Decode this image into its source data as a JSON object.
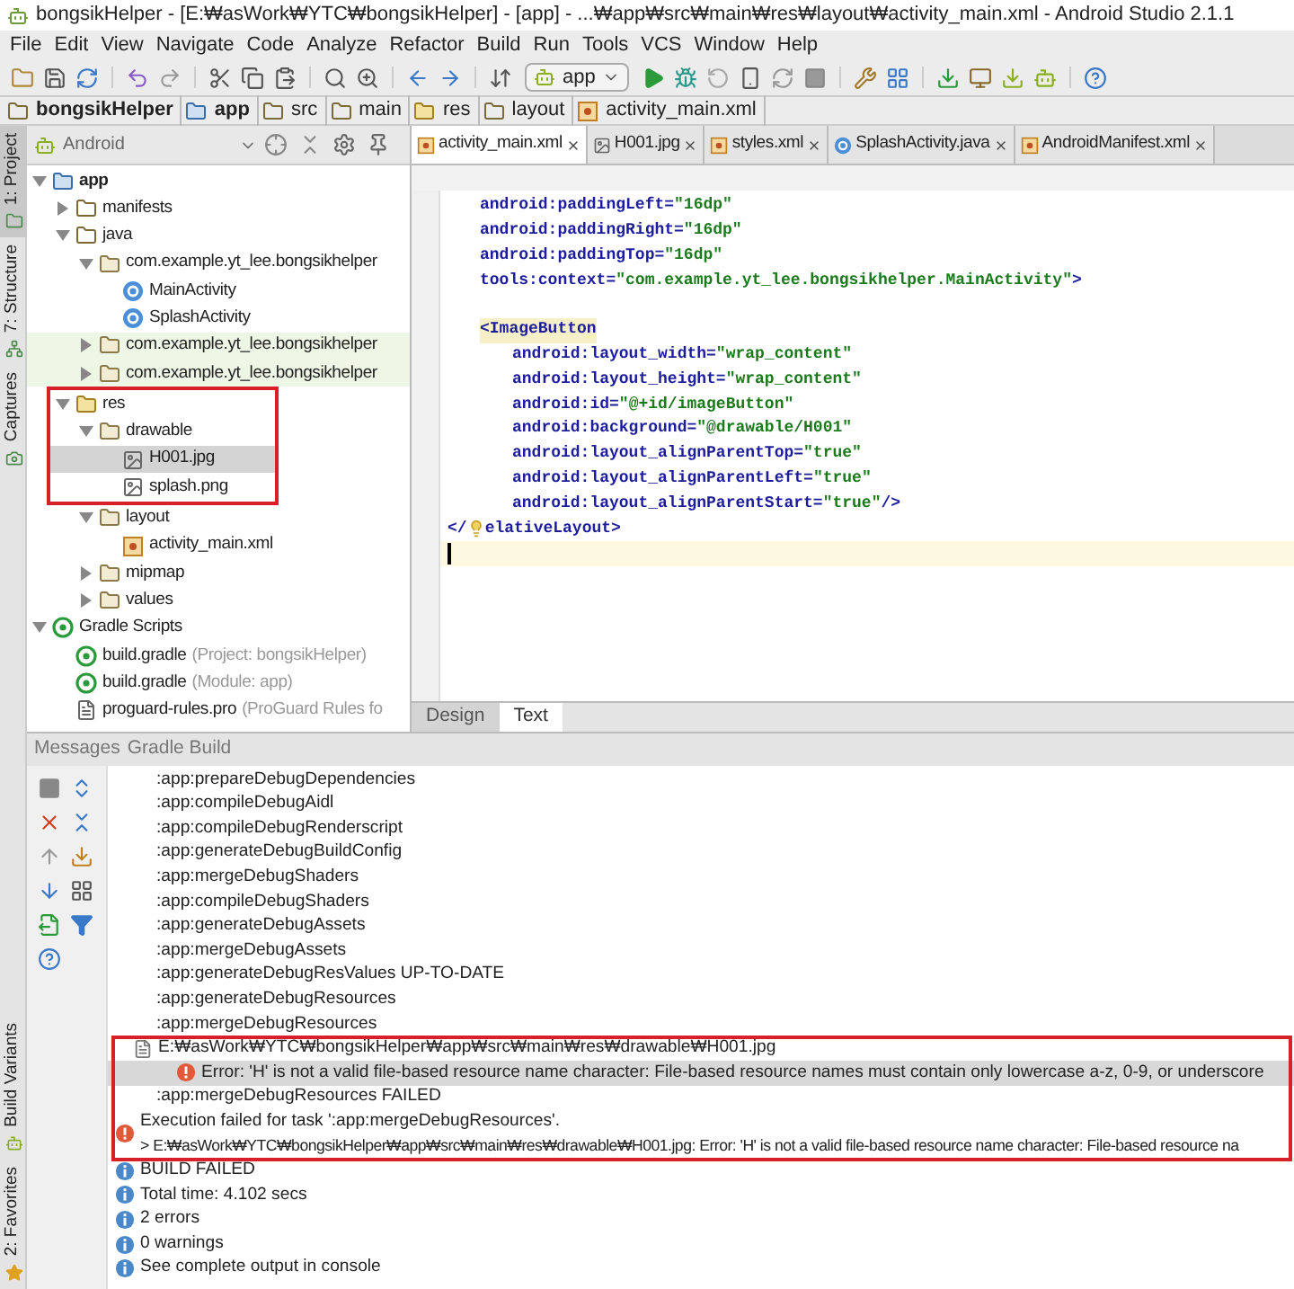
{
  "window": {
    "title": "bongsikHelper - [E:₩asWork₩YTC₩bongsikHelper] - [app] - ...₩app₩src₩main₩res₩layout₩activity_main.xml - Android Studio 2.1.1"
  },
  "menu": [
    "File",
    "Edit",
    "View",
    "Navigate",
    "Code",
    "Analyze",
    "Refactor",
    "Build",
    "Run",
    "Tools",
    "VCS",
    "Window",
    "Help"
  ],
  "toolbar": {
    "run_config": "app"
  },
  "breadcrumb": [
    {
      "label": "bongsikHelper",
      "kind": "project"
    },
    {
      "label": "app",
      "kind": "module"
    },
    {
      "label": "src",
      "kind": "folder"
    },
    {
      "label": "main",
      "kind": "folder"
    },
    {
      "label": "res",
      "kind": "res"
    },
    {
      "label": "layout",
      "kind": "folder"
    },
    {
      "label": "activity_main.xml",
      "kind": "xml"
    }
  ],
  "tool_strip": {
    "top": [
      {
        "label": "1: Project",
        "kind": "project",
        "selected": true
      },
      {
        "label": "7: Structure",
        "kind": "structure",
        "selected": false
      },
      {
        "label": "Captures",
        "kind": "captures",
        "selected": false
      }
    ],
    "bottom": [
      {
        "label": "Build Variants",
        "kind": "android",
        "selected": false
      },
      {
        "label": "2: Favorites",
        "kind": "star",
        "selected": false
      }
    ]
  },
  "project": {
    "view": "Android",
    "tree": [
      {
        "label": "app",
        "kind": "module",
        "expanded": true,
        "selected": false,
        "children": [
          {
            "label": "manifests",
            "kind": "folder",
            "expanded": false,
            "selected": false
          },
          {
            "label": "java",
            "kind": "folder",
            "expanded": true,
            "selected": false,
            "children": [
              {
                "label": "com.example.yt_lee.bongsikhelper",
                "kind": "package",
                "expanded": true,
                "selected": false,
                "children": [
                  {
                    "label": "MainActivity",
                    "kind": "class",
                    "selected": false
                  },
                  {
                    "label": "SplashActivity",
                    "kind": "class",
                    "selected": false
                  }
                ]
              },
              {
                "label": "com.example.yt_lee.bongsikhelper",
                "kind": "test_package",
                "expanded": false,
                "selected": false
              },
              {
                "label": "com.example.yt_lee.bongsikhelper",
                "kind": "test_package",
                "expanded": false,
                "selected": false
              }
            ]
          },
          {
            "label": "res",
            "kind": "res",
            "expanded": true,
            "selected": false,
            "children": [
              {
                "label": "drawable",
                "kind": "package",
                "expanded": true,
                "selected": false,
                "children": [
                  {
                    "label": "H001.jpg",
                    "kind": "image",
                    "selected": true
                  },
                  {
                    "label": "splash.png",
                    "kind": "image",
                    "selected": false
                  }
                ]
              },
              {
                "label": "layout",
                "kind": "package",
                "expanded": true,
                "selected": false,
                "children": [
                  {
                    "label": "activity_main.xml",
                    "kind": "xml",
                    "selected": false
                  }
                ]
              },
              {
                "label": "mipmap",
                "kind": "package",
                "expanded": false,
                "selected": false
              },
              {
                "label": "values",
                "kind": "package",
                "expanded": false,
                "selected": false
              }
            ]
          }
        ]
      },
      {
        "label": "Gradle Scripts",
        "kind": "gradle",
        "expanded": true,
        "selected": false,
        "children": [
          {
            "label": "build.gradle",
            "note": "(Project: bongsikHelper)",
            "kind": "gradle",
            "selected": false
          },
          {
            "label": "build.gradle",
            "note": "(Module: app)",
            "kind": "gradle",
            "selected": false
          },
          {
            "label": "proguard-rules.pro",
            "note": "(ProGuard Rules fo",
            "kind": "file",
            "selected": false
          }
        ]
      }
    ]
  },
  "editor": {
    "tabs": [
      {
        "label": "activity_main.xml",
        "kind": "xml",
        "selected": true
      },
      {
        "label": "H001.jpg",
        "kind": "image",
        "selected": false
      },
      {
        "label": "styles.xml",
        "kind": "xml",
        "selected": false
      },
      {
        "label": "SplashActivity.java",
        "kind": "class",
        "selected": false
      },
      {
        "label": "AndroidManifest.xml",
        "kind": "xml",
        "selected": false
      }
    ],
    "lines": [
      {
        "kind": "group",
        "children": [
          {
            "kind": "code",
            "current": false,
            "segments": [
              {
                "kind": "attr",
                "text": "android:paddingLeft="
              },
              {
                "kind": "value",
                "text": "\"16dp\""
              }
            ]
          },
          {
            "kind": "code",
            "current": false,
            "segments": [
              {
                "kind": "attr",
                "text": "android:paddingRight="
              },
              {
                "kind": "value",
                "text": "\"16dp\""
              }
            ]
          },
          {
            "kind": "code",
            "current": false,
            "segments": [
              {
                "kind": "attr",
                "text": "android:paddingTop="
              },
              {
                "kind": "value",
                "text": "\"16dp\""
              }
            ]
          },
          {
            "kind": "code",
            "current": false,
            "segments": [
              {
                "kind": "attr",
                "text": "tools:context="
              },
              {
                "kind": "value",
                "text": "\"com.example.yt_lee.bongsikhelper.MainActivity\""
              },
              {
                "kind": "tag",
                "text": ">"
              }
            ]
          },
          {
            "kind": "blank"
          },
          {
            "kind": "code",
            "current": false,
            "segments": [
              {
                "kind": "tag_hl",
                "text": "<ImageButton"
              }
            ],
            "children": [
              {
                "kind": "code",
                "current": false,
                "segments": [
                  {
                    "kind": "attr",
                    "text": "android:layout_width="
                  },
                  {
                    "kind": "value",
                    "text": "\"wrap_content\""
                  }
                ]
              },
              {
                "kind": "code",
                "current": false,
                "segments": [
                  {
                    "kind": "attr",
                    "text": "android:layout_height="
                  },
                  {
                    "kind": "value",
                    "text": "\"wrap_content\""
                  }
                ]
              },
              {
                "kind": "code",
                "current": false,
                "segments": [
                  {
                    "kind": "attr",
                    "text": "android:id="
                  },
                  {
                    "kind": "value",
                    "text": "\"@+id/imageButton\""
                  }
                ]
              },
              {
                "kind": "code",
                "current": false,
                "segments": [
                  {
                    "kind": "attr",
                    "text": "android:background="
                  },
                  {
                    "kind": "value",
                    "text": "\"@drawable/H001\""
                  }
                ]
              },
              {
                "kind": "code",
                "current": false,
                "segments": [
                  {
                    "kind": "attr",
                    "text": "android:layout_alignParentTop="
                  },
                  {
                    "kind": "value",
                    "text": "\"true\""
                  }
                ]
              },
              {
                "kind": "code",
                "current": false,
                "segments": [
                  {
                    "kind": "attr",
                    "text": "android:layout_alignParentLeft="
                  },
                  {
                    "kind": "value",
                    "text": "\"true\""
                  }
                ]
              },
              {
                "kind": "code",
                "current": false,
                "segments": [
                  {
                    "kind": "attr",
                    "text": "android:layout_alignParentStart="
                  },
                  {
                    "kind": "value",
                    "text": "\"true\""
                  },
                  {
                    "kind": "tag",
                    "text": " />"
                  }
                ]
              }
            ]
          }
        ]
      },
      {
        "kind": "code",
        "current": false,
        "segments": [
          {
            "kind": "tag",
            "text": "</"
          },
          {
            "kind": "bulb"
          },
          {
            "kind": "tag",
            "text": "elativeLayout>"
          }
        ]
      },
      {
        "kind": "code",
        "current": true,
        "segments": [
          {
            "kind": "caret"
          }
        ]
      }
    ],
    "view_tabs": [
      {
        "label": "Design",
        "selected": false
      },
      {
        "label": "Text",
        "selected": true
      }
    ]
  },
  "messages": {
    "title": "Messages",
    "tab": "Gradle Build",
    "lines": [
      {
        "kind": "task",
        "text": ":app:prepareDebugDependencies",
        "selected": false
      },
      {
        "kind": "task",
        "text": ":app:compileDebugAidl",
        "selected": false
      },
      {
        "kind": "task",
        "text": ":app:compileDebugRenderscript",
        "selected": false
      },
      {
        "kind": "task",
        "text": ":app:generateDebugBuildConfig",
        "selected": false
      },
      {
        "kind": "task",
        "text": ":app:mergeDebugShaders",
        "selected": false
      },
      {
        "kind": "task",
        "text": ":app:compileDebugShaders",
        "selected": false
      },
      {
        "kind": "task",
        "text": ":app:generateDebugAssets",
        "selected": false
      },
      {
        "kind": "task",
        "text": ":app:mergeDebugAssets",
        "selected": false
      },
      {
        "kind": "task",
        "text": ":app:generateDebugResValues UP-TO-DATE",
        "selected": false
      },
      {
        "kind": "task",
        "text": ":app:generateDebugResources",
        "selected": false
      },
      {
        "kind": "task",
        "text": ":app:mergeDebugResources",
        "selected": false
      },
      {
        "kind": "file",
        "text": "E:₩asWork₩YTC₩bongsikHelper₩app₩src₩main₩res₩drawable₩H001.jpg",
        "selected": false
      },
      {
        "kind": "error",
        "text": "Error: 'H' is not a valid file-based resource name character: File-based resource names must contain only lowercase a-z, 0-9, or underscore",
        "selected": true
      },
      {
        "kind": "task",
        "text": ":app:mergeDebugResources FAILED",
        "selected": false
      },
      {
        "kind": "failure",
        "text": "Execution failed for task ':app:mergeDebugResources'.",
        "detail": "> E:₩asWork₩YTC₩bongsikHelper₩app₩src₩main₩res₩drawable₩H001.jpg: Error: 'H' is not a valid file-based resource name character: File-based resource na",
        "selected": false
      },
      {
        "kind": "info",
        "text": "BUILD FAILED",
        "selected": false
      },
      {
        "kind": "info",
        "text": "Total time: 4.102 secs",
        "selected": false
      },
      {
        "kind": "info",
        "text": "2 errors",
        "selected": false
      },
      {
        "kind": "info",
        "text": "0 warnings",
        "selected": false
      },
      {
        "kind": "info",
        "text": "See complete output in console",
        "selected": false
      }
    ]
  }
}
